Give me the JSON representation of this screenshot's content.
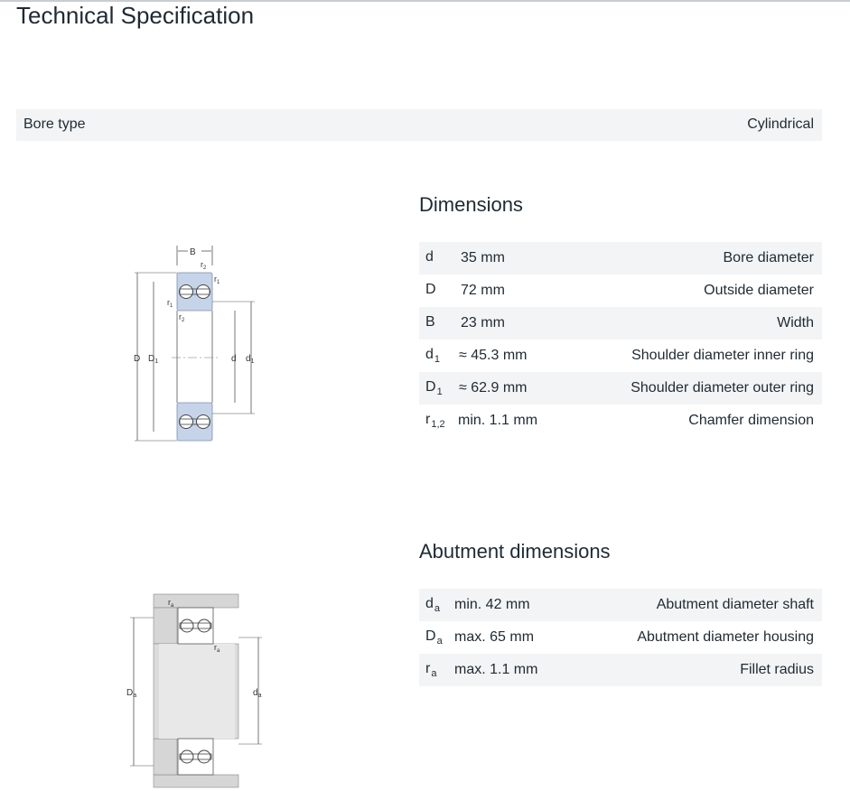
{
  "page": {
    "title": "Technical Specification",
    "bore_type": {
      "label": "Bore type",
      "value": "Cylindrical"
    }
  },
  "dimensions": {
    "heading": "Dimensions",
    "rows": [
      {
        "sym": "d",
        "sub": "",
        "value": "35  mm",
        "desc": "Bore diameter"
      },
      {
        "sym": "D",
        "sub": "",
        "value": "72  mm",
        "desc": "Outside diameter"
      },
      {
        "sym": "B",
        "sub": "",
        "value": "23  mm",
        "desc": "Width"
      },
      {
        "sym": "d",
        "sub": "1",
        "value": "≈ 45.3  mm",
        "desc": "Shoulder diameter inner ring"
      },
      {
        "sym": "D",
        "sub": "1",
        "value": "≈ 62.9  mm",
        "desc": "Shoulder diameter outer ring"
      },
      {
        "sym": "r",
        "sub": "1,2",
        "value": "min. 1.1  mm",
        "desc": "Chamfer dimension"
      }
    ]
  },
  "abutment": {
    "heading": "Abutment dimensions",
    "rows": [
      {
        "sym": "d",
        "sub": "a",
        "value": "min. 42  mm",
        "desc": "Abutment diameter shaft"
      },
      {
        "sym": "D",
        "sub": "a",
        "value": "max. 65  mm",
        "desc": "Abutment diameter housing"
      },
      {
        "sym": "r",
        "sub": "a",
        "value": "max. 1.1  mm",
        "desc": "Fillet radius"
      }
    ]
  },
  "diagram1": {
    "label_B": "B",
    "label_r2": "r",
    "label_r2_sub": "2",
    "label_r1": "r",
    "label_r1_sub": "1",
    "label_D": "D",
    "label_D1": "D",
    "label_D1_sub": "1",
    "label_d": "d",
    "label_d1": "d",
    "label_d1_sub": "1"
  },
  "diagram2": {
    "label_ra": "r",
    "label_ra_sub": "a",
    "label_Da": "D",
    "label_Da_sub": "a",
    "label_da": "d",
    "label_da_sub": "a"
  }
}
